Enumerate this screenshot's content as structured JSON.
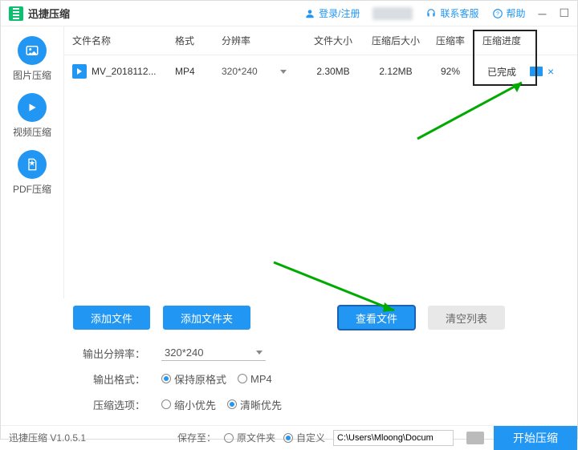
{
  "title": "迅捷压缩",
  "header": {
    "login": "登录/注册",
    "contact": "联系客服",
    "help": "帮助"
  },
  "sidebar": {
    "items": [
      {
        "label": "图片压缩"
      },
      {
        "label": "视频压缩"
      },
      {
        "label": "PDF压缩"
      }
    ]
  },
  "table": {
    "headers": {
      "name": "文件名称",
      "format": "格式",
      "resolution": "分辨率",
      "size": "文件大小",
      "after": "压缩后大小",
      "rate": "压缩率",
      "progress": "压缩进度"
    },
    "rows": [
      {
        "name": "MV_2018112...",
        "format": "MP4",
        "resolution": "320*240",
        "size": "2.30MB",
        "after": "2.12MB",
        "rate": "92%",
        "progress": "已完成"
      }
    ]
  },
  "buttons": {
    "add_file": "添加文件",
    "add_folder": "添加文件夹",
    "view_file": "查看文件",
    "clear_list": "清空列表"
  },
  "options": {
    "out_res_label": "输出分辨率：",
    "out_res_value": "320*240",
    "out_fmt_label": "输出格式：",
    "fmt_keep": "保持原格式",
    "fmt_mp4": "MP4",
    "compress_opt_label": "压缩选项：",
    "opt_small": "缩小优先",
    "opt_clear": "清晰优先"
  },
  "bottom": {
    "version": "迅捷压缩 V1.0.5.1",
    "saveto_label": "保存至：",
    "same_folder": "原文件夹",
    "custom": "自定义",
    "path": "C:\\Users\\Mloong\\Docum",
    "start": "开始压缩"
  }
}
